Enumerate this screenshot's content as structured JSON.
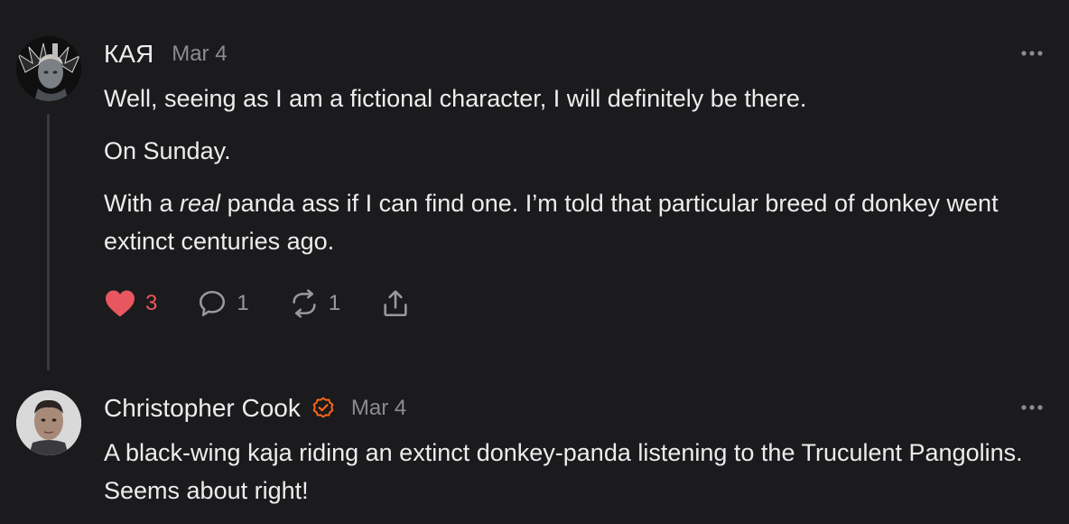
{
  "comments": [
    {
      "author": "КАЯ",
      "date": "Mar 4",
      "paragraphs": {
        "p1": "Well, seeing as I am a fictional character, I will definitely be there.",
        "p2": "On Sunday.",
        "p3_before": "With a ",
        "p3_em": "real",
        "p3_after": " panda ass if I can find one. I’m told that particular breed of donkey went extinct centuries ago."
      },
      "actions": {
        "likes": "3",
        "replies": "1",
        "restacks": "1"
      },
      "liked": true
    },
    {
      "author": "Christopher Cook",
      "verified": true,
      "date": "Mar 4",
      "text": "A black-wing kaja riding an extinct donkey-panda listening to the Truculent Pangolins. Seems about right!"
    }
  ],
  "colors": {
    "background": "#1b1b1d",
    "like": "#e8575f",
    "verified_badge": "#ff6719",
    "muted": "#8c8c8f"
  },
  "icons": {
    "like": "heart-icon",
    "reply": "comment-bubble-icon",
    "restack": "restack-icon",
    "share": "share-icon",
    "more": "more-options-icon",
    "verified": "verified-badge-icon"
  }
}
